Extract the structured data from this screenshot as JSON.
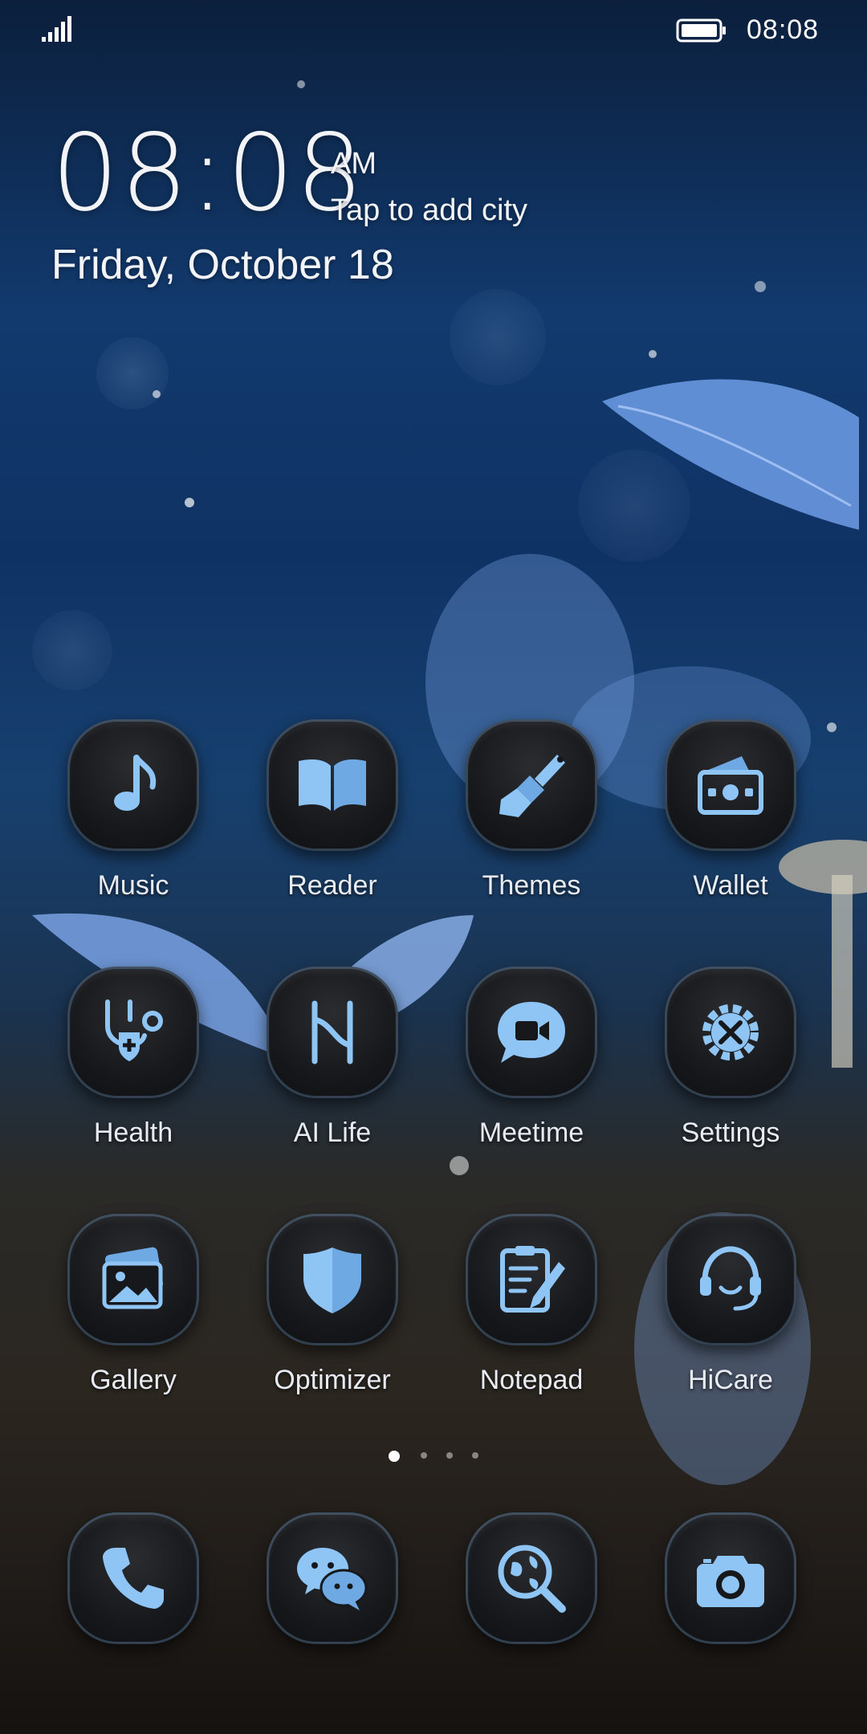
{
  "status_bar": {
    "time": "08:08",
    "signal_icon": "signal-strength-icon",
    "battery_icon": "battery-full-icon"
  },
  "clock_widget": {
    "time": "08:08",
    "am_pm": "AM",
    "city_prompt": "Tap to add city",
    "date": "Friday, October 18"
  },
  "apps": [
    {
      "label": "Music",
      "icon": "music-note-icon"
    },
    {
      "label": "Reader",
      "icon": "open-book-icon"
    },
    {
      "label": "Themes",
      "icon": "paint-brush-icon"
    },
    {
      "label": "Wallet",
      "icon": "wallet-icon"
    },
    {
      "label": "Health",
      "icon": "stethoscope-icon"
    },
    {
      "label": "AI Life",
      "icon": "ai-life-icon"
    },
    {
      "label": "Meetime",
      "icon": "video-chat-icon"
    },
    {
      "label": "Settings",
      "icon": "gear-tools-icon"
    },
    {
      "label": "Gallery",
      "icon": "photos-icon"
    },
    {
      "label": "Optimizer",
      "icon": "shield-icon"
    },
    {
      "label": "Notepad",
      "icon": "clipboard-pencil-icon"
    },
    {
      "label": "HiCare",
      "icon": "headset-icon"
    }
  ],
  "page_indicator": {
    "pages": 4,
    "current": 1
  },
  "dock": [
    {
      "icon": "phone-icon"
    },
    {
      "icon": "chat-bubbles-icon"
    },
    {
      "icon": "globe-search-icon"
    },
    {
      "icon": "camera-icon"
    }
  ],
  "colors": {
    "icon_accent": "#8ec5f5",
    "icon_accent_dark": "#5c98d8",
    "tile_bg": "#16181b",
    "label_text": "#e8ecf2"
  }
}
